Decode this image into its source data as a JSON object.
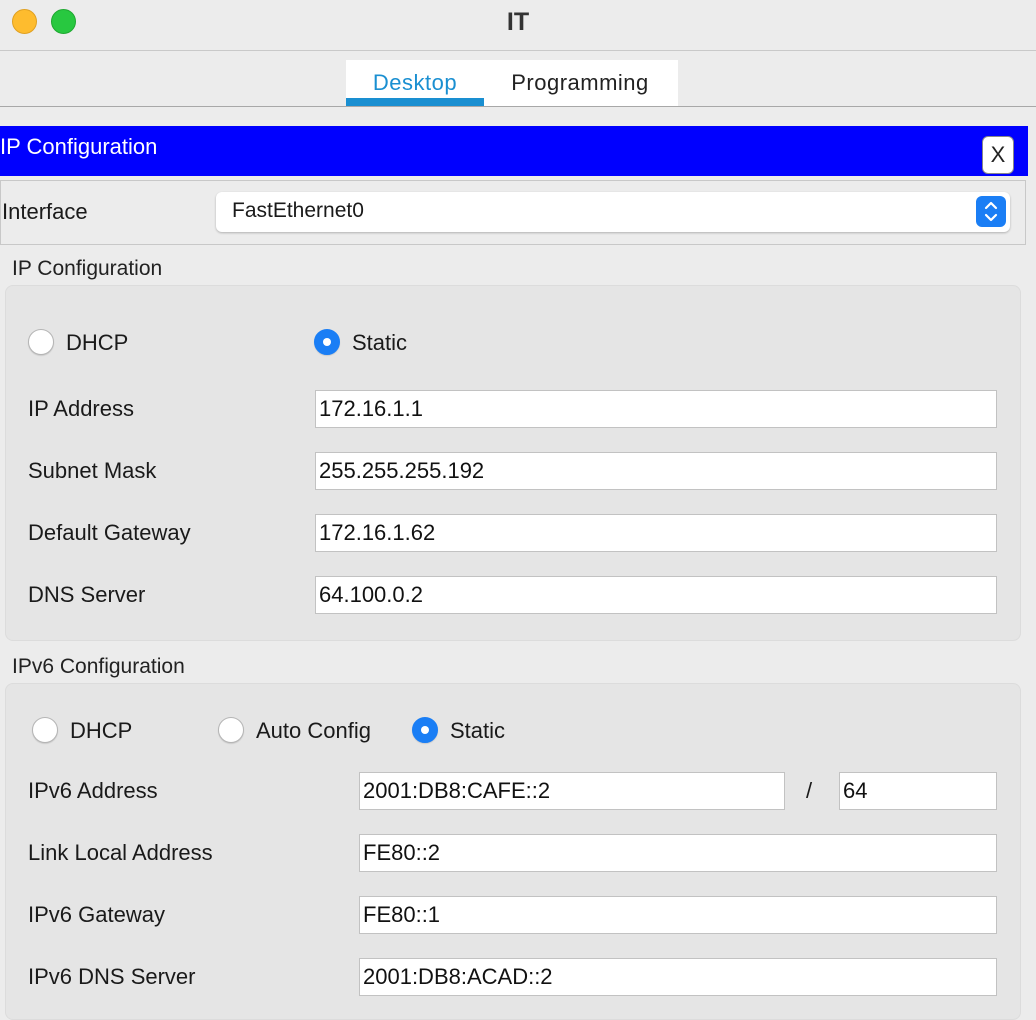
{
  "window": {
    "title": "IT"
  },
  "tabs": [
    {
      "label": "Desktop",
      "active": true
    },
    {
      "label": "Programming",
      "active": false
    }
  ],
  "header": {
    "title": "IP Configuration",
    "close_label": "X",
    "color": "#0000ff"
  },
  "interface": {
    "label": "Interface",
    "value": "FastEthernet0"
  },
  "ipv4": {
    "section_label": "IP Configuration",
    "modes": [
      {
        "label": "DHCP",
        "selected": false
      },
      {
        "label": "Static",
        "selected": true
      }
    ],
    "fields": {
      "ip_address": {
        "label": "IP Address",
        "value": "172.16.1.1"
      },
      "subnet_mask": {
        "label": "Subnet Mask",
        "value": "255.255.255.192"
      },
      "default_gateway": {
        "label": "Default Gateway",
        "value": "172.16.1.62"
      },
      "dns_server": {
        "label": "DNS Server",
        "value": "64.100.0.2"
      }
    }
  },
  "ipv6": {
    "section_label": "IPv6 Configuration",
    "modes": [
      {
        "label": "DHCP",
        "selected": false
      },
      {
        "label": "Auto Config",
        "selected": false
      },
      {
        "label": "Static",
        "selected": true
      }
    ],
    "fields": {
      "address": {
        "label": "IPv6 Address",
        "value": "2001:DB8:CAFE::2",
        "separator": "/",
        "prefix": "64"
      },
      "link_local": {
        "label": "Link Local Address",
        "value": "FE80::2"
      },
      "gateway": {
        "label": "IPv6 Gateway",
        "value": "FE80::1"
      },
      "dns_server": {
        "label": "IPv6 DNS Server",
        "value": "2001:DB8:ACAD::2"
      }
    }
  },
  "colors": {
    "accent": "#1a8fd1",
    "radio_selected": "#1a7ef5"
  }
}
